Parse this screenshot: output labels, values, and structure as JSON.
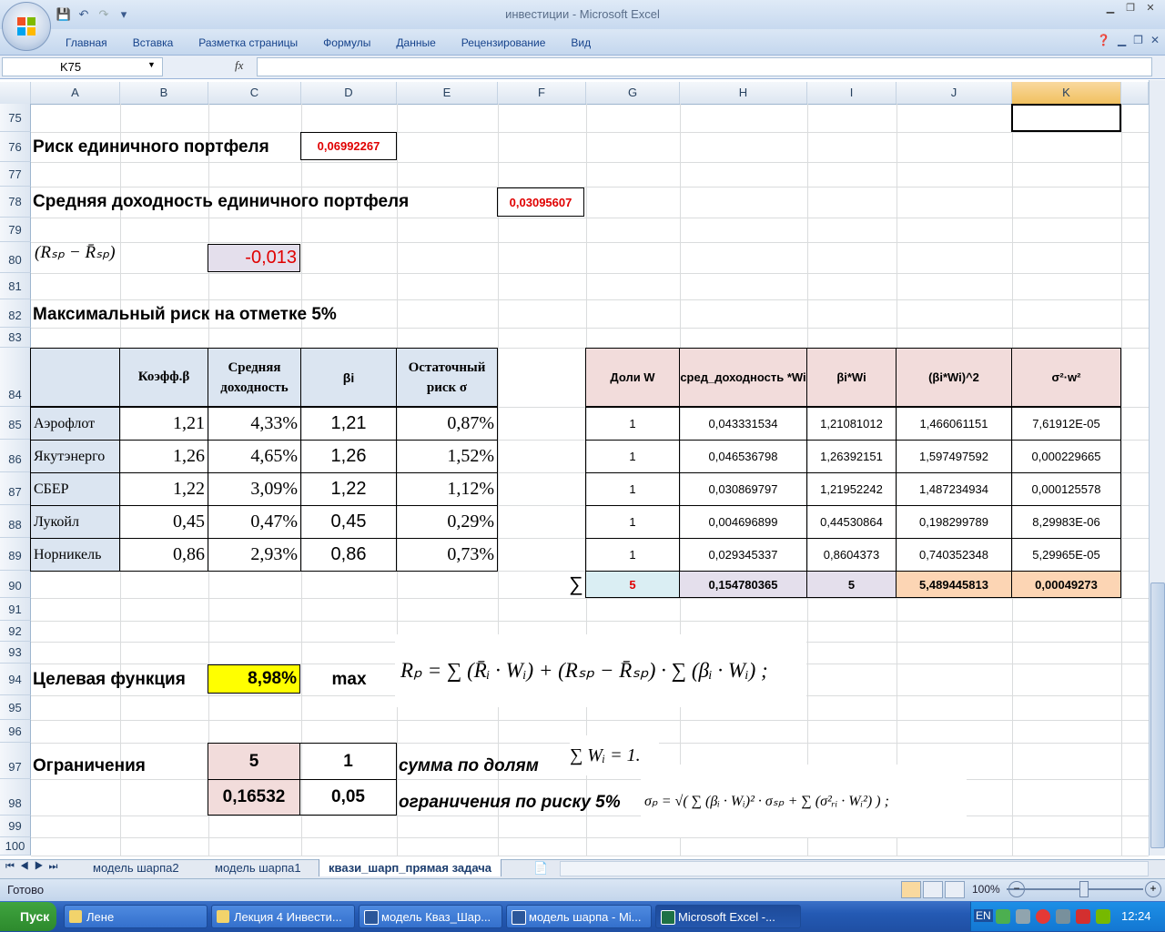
{
  "app": {
    "title": "инвестиции - Microsoft Excel",
    "ribbon_tabs": [
      "Главная",
      "Вставка",
      "Разметка страницы",
      "Формулы",
      "Данные",
      "Рецензирование",
      "Вид"
    ]
  },
  "formula_bar": {
    "name_box": "K75",
    "fx": "fx",
    "formula": ""
  },
  "columns": [
    "A",
    "B",
    "C",
    "D",
    "E",
    "F",
    "G",
    "H",
    "I",
    "J",
    "K"
  ],
  "rows": [
    "75",
    "76",
    "77",
    "78",
    "79",
    "80",
    "81",
    "82",
    "83",
    "84",
    "85",
    "86",
    "87",
    "88",
    "89",
    "90",
    "91",
    "92",
    "93",
    "94",
    "95",
    "96",
    "97",
    "98",
    "99",
    "100"
  ],
  "sheet": {
    "r76_label": "Риск единичного портфеля",
    "r76_value": "0,06992267",
    "r78_label": "Средняя доходность единичного портфеля",
    "r78_value": "0,03095607",
    "r80_formula": "(Rₛₚ − R̄ₛₚ)",
    "r80_value": "-0,013",
    "r82_label": "Максимальный риск на отметке 5%",
    "left_table": {
      "headers": [
        "",
        "Коэфф.β",
        "Средняя доходность",
        "βi",
        "Остаточный риск σ"
      ],
      "rows": [
        [
          "Аэрофлот",
          "1,21",
          "4,33%",
          "1,21",
          "0,87%"
        ],
        [
          "Якутэнерго",
          "1,26",
          "4,65%",
          "1,26",
          "1,52%"
        ],
        [
          "СБЕР",
          "1,22",
          "3,09%",
          "1,22",
          "1,12%"
        ],
        [
          "Лукойл",
          "0,45",
          "0,47%",
          "0,45",
          "0,29%"
        ],
        [
          "Норникель",
          "0,86",
          "2,93%",
          "0,86",
          "0,73%"
        ]
      ]
    },
    "right_table": {
      "headers": [
        "Доли W",
        "сред_доходность *Wi",
        "βi*Wi",
        "(βi*Wi)^2",
        "σ²·w²"
      ],
      "rows": [
        [
          "1",
          "0,043331534",
          "1,21081012",
          "1,466061151",
          "7,61912E-05"
        ],
        [
          "1",
          "0,046536798",
          "1,26392151",
          "1,597497592",
          "0,000229665"
        ],
        [
          "1",
          "0,030869797",
          "1,21952242",
          "1,487234934",
          "0,000125578"
        ],
        [
          "1",
          "0,004696899",
          "0,44530864",
          "0,198299789",
          "8,29983E-06"
        ],
        [
          "1",
          "0,029345337",
          "0,8604373",
          "0,740352348",
          "5,29965E-05"
        ]
      ],
      "sum_symbol": "∑",
      "totals": [
        "5",
        "0,154780365",
        "5",
        "5,489445813",
        "0,00049273"
      ]
    },
    "r94_label": "Целевая функция",
    "r94_value": "8,98%",
    "r94_max": "max",
    "r97_label": "Ограничения",
    "r97_c": "5",
    "r97_d": "1",
    "r97_e": "сумма по долям",
    "r98_c": "0,16532",
    "r98_d": "0,05",
    "r98_e": "ограничения по риску 5%",
    "formula_rp": "Rₚ = ∑ (R̄ᵢ · Wᵢ) + (Rₛₚ − R̄ₛₚ) · ∑ (βᵢ · Wᵢ) ;",
    "formula_sum_w": "∑ Wᵢ = 1.",
    "formula_sigma": "σₚ = √( ∑ (βᵢ · Wᵢ)² · σₛₚ + ∑ (σ²ᵣᵢ · Wᵢ²) ) ;"
  },
  "sheet_tabs": [
    "модель шарпа2",
    "модель шарпа1",
    "квази_шарп_прямая задача"
  ],
  "status": {
    "ready": "Готово",
    "zoom": "100%"
  },
  "taskbar": {
    "start": "Пуск",
    "items": [
      "Лене",
      "Лекция 4 Инвести...",
      "модель Кваз_Шар...",
      "модель шарпа - Mi...",
      "Microsoft Excel -..."
    ],
    "lang": "EN",
    "clock": "12:24"
  },
  "colors": {
    "accent": "#15428b",
    "selected_col": "#f1c15f",
    "red": "#e00000"
  }
}
